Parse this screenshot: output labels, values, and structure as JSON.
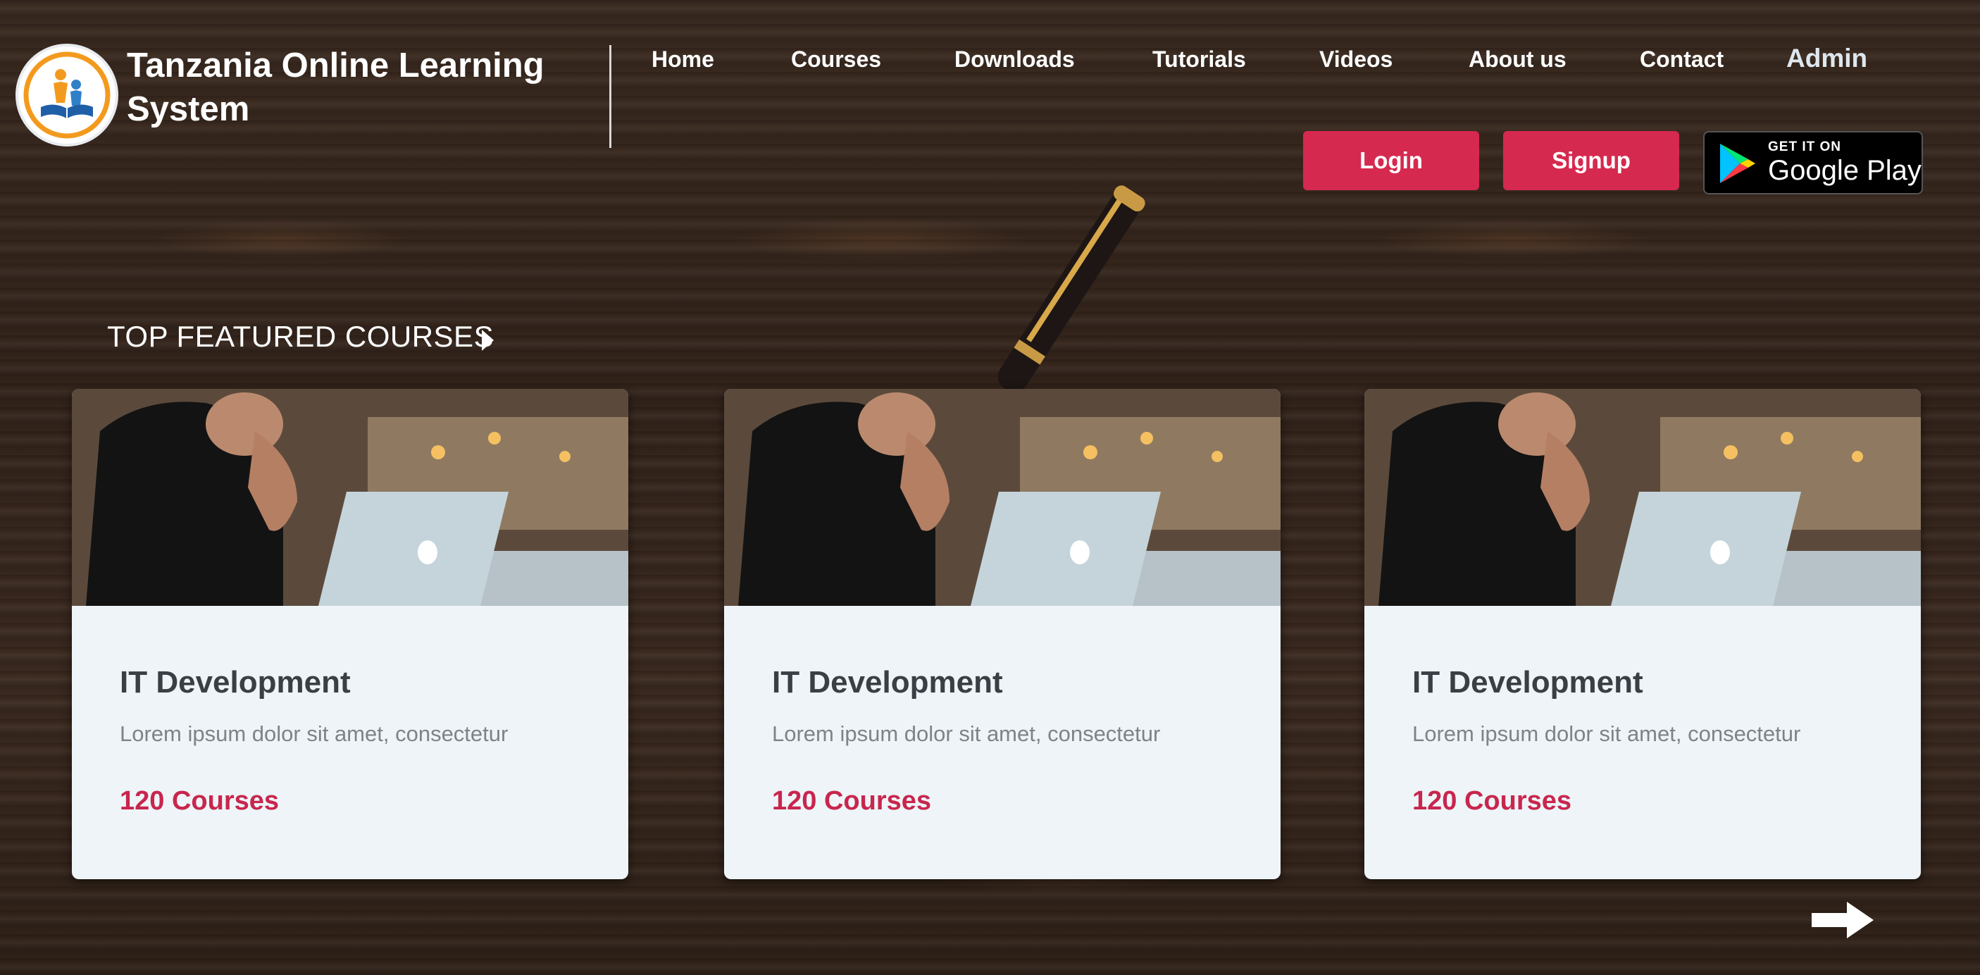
{
  "brand": {
    "line1": "Tanzania Online Learning",
    "line2": "System"
  },
  "nav": {
    "items": [
      {
        "label": "Home"
      },
      {
        "label": "Courses"
      },
      {
        "label": "Downloads"
      },
      {
        "label": "Tutorials"
      },
      {
        "label": "Videos"
      },
      {
        "label": "About us"
      },
      {
        "label": "Contact"
      }
    ],
    "admin": "Admin"
  },
  "auth": {
    "login": "Login",
    "signup": "Signup"
  },
  "google_play": {
    "small": "GET IT ON",
    "big": "Google Play"
  },
  "section": {
    "title": "TOP FEATURED COURSES"
  },
  "cards": [
    {
      "title": "IT Development",
      "description": "Lorem ipsum dolor sit amet, consectetur",
      "count": "120 Courses"
    },
    {
      "title": "IT Development",
      "description": "Lorem ipsum dolor sit amet, consectetur",
      "count": "120 Courses"
    },
    {
      "title": "IT Development",
      "description": "Lorem ipsum dolor sit amet, consectetur",
      "count": "120 Courses"
    }
  ],
  "colors": {
    "accent": "#d6294f",
    "card_bg": "#eef4f7",
    "count_text": "#c8264e"
  },
  "icons": {
    "next": "arrow-right-icon",
    "section": "caret-right-icon",
    "logo": "book-reader-logo-icon"
  }
}
